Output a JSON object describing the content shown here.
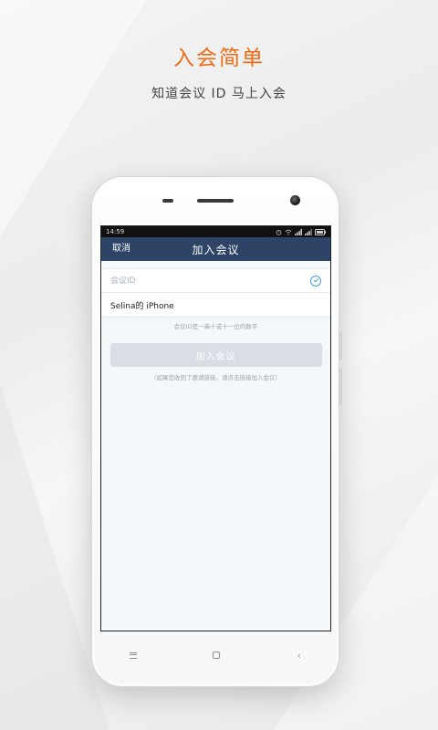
{
  "headline": "入会简单",
  "subline": "知道会议 ID 马上入会",
  "status_bar": {
    "time": "14:59"
  },
  "nav": {
    "cancel_label": "取消",
    "title": "加入会议"
  },
  "form": {
    "meeting_id_placeholder": "会议ID",
    "meeting_id_value": "",
    "display_name": "Selina的 iPhone"
  },
  "hint": "会议ID是一串十或十一位的数字",
  "join_button_label": "加入会议",
  "tip": "（如果您收到了邀请链接，请点击链接加入会议）",
  "colors": {
    "accent_orange": "#f06a14",
    "nav_bar": "#2d4467",
    "button_disabled": "#d9dee5",
    "check_icon": "#3fa0d8"
  },
  "icons": {
    "status": [
      "alarm-icon",
      "wifi-icon",
      "signal-icon",
      "signal-icon",
      "battery-icon"
    ],
    "field": "check-circle-icon",
    "softkeys": [
      "menu-icon",
      "home-icon",
      "back-icon"
    ]
  }
}
